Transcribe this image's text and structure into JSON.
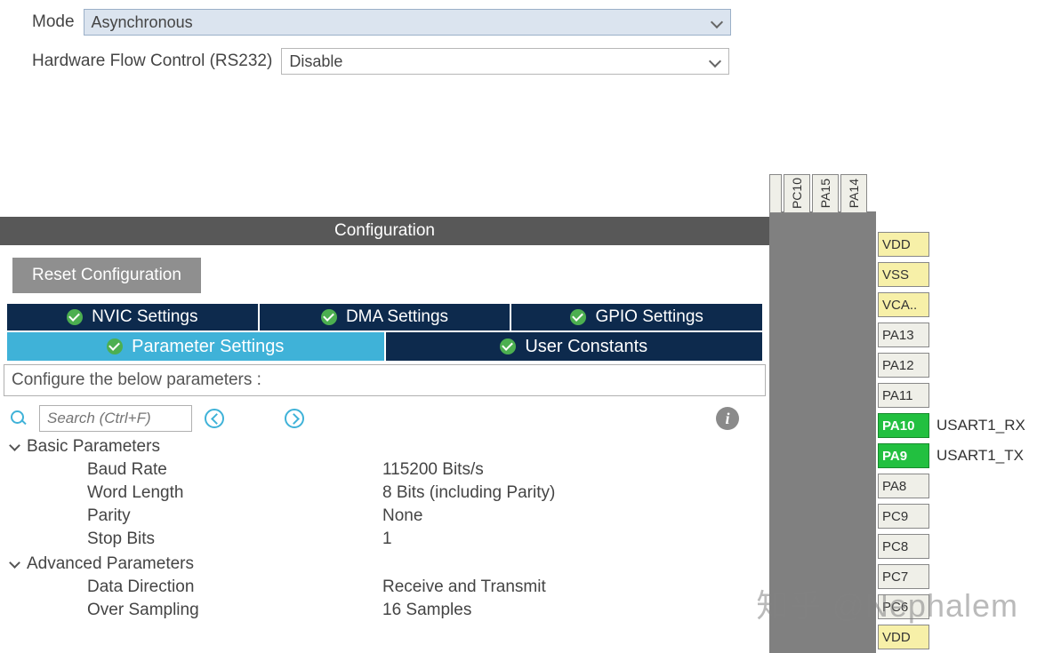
{
  "form": {
    "mode_label": "Mode",
    "mode_value": "Asynchronous",
    "flow_label": "Hardware Flow Control (RS232)",
    "flow_value": "Disable"
  },
  "config_header": "Configuration",
  "reset_button": "Reset Configuration",
  "tabs_top": [
    {
      "label": "NVIC Settings"
    },
    {
      "label": "DMA Settings"
    },
    {
      "label": "GPIO Settings"
    }
  ],
  "tabs_bottom": [
    {
      "label": "Parameter Settings",
      "active": true
    },
    {
      "label": "User Constants",
      "active": false
    }
  ],
  "configure_text": "Configure the below parameters :",
  "search_placeholder": "Search (Ctrl+F)",
  "groups": {
    "basic_header": "Basic Parameters",
    "advanced_header": "Advanced Parameters"
  },
  "params": {
    "baud_label": "Baud Rate",
    "baud_value": "115200 Bits/s",
    "wordlen_label": "Word Length",
    "wordlen_value": "8 Bits (including Parity)",
    "parity_label": "Parity",
    "parity_value": "None",
    "stopbits_label": "Stop Bits",
    "stopbits_value": "1",
    "datadir_label": "Data Direction",
    "datadir_value": "Receive and Transmit",
    "oversamp_label": "Over Sampling",
    "oversamp_value": "16 Samples"
  },
  "pins_top": [
    "PC10",
    "PA15",
    "PA14"
  ],
  "pins_side": [
    {
      "name": "VDD",
      "class": "yellow",
      "func": ""
    },
    {
      "name": "VSS",
      "class": "yellow",
      "func": ""
    },
    {
      "name": "VCA..",
      "class": "yellow",
      "func": ""
    },
    {
      "name": "PA13",
      "class": "",
      "func": ""
    },
    {
      "name": "PA12",
      "class": "",
      "func": ""
    },
    {
      "name": "PA11",
      "class": "",
      "func": ""
    },
    {
      "name": "PA10",
      "class": "green",
      "func": "USART1_RX"
    },
    {
      "name": "PA9",
      "class": "green",
      "func": "USART1_TX"
    },
    {
      "name": "PA8",
      "class": "",
      "func": ""
    },
    {
      "name": "PC9",
      "class": "",
      "func": ""
    },
    {
      "name": "PC8",
      "class": "",
      "func": ""
    },
    {
      "name": "PC7",
      "class": "",
      "func": ""
    },
    {
      "name": "PC6",
      "class": "",
      "func": ""
    },
    {
      "name": "VDD",
      "class": "yellow",
      "func": ""
    }
  ],
  "watermark": "知乎 @Nephalem"
}
